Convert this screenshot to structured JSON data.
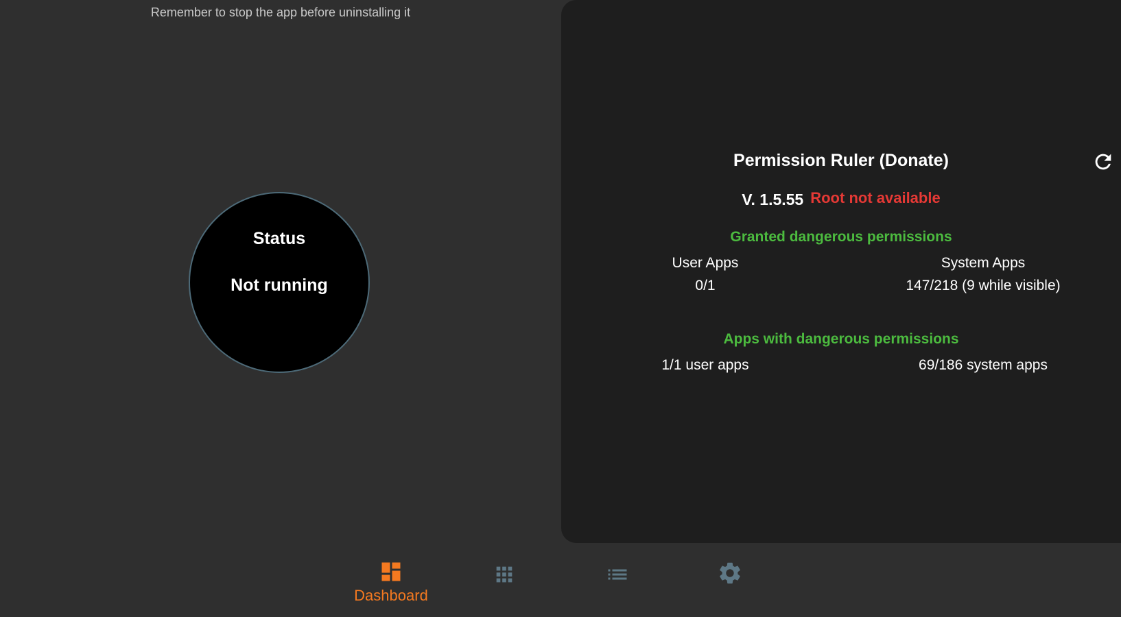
{
  "left_pane": {
    "hint": "Remember to stop the app before uninstalling it",
    "status_title": "Status",
    "status_value": "Not running"
  },
  "info_card": {
    "app_title": "Permission Ruler (Donate)",
    "refresh_icon": "refresh-icon",
    "version": "V. 1.5.55",
    "root_status": "Root not available",
    "granted_section": {
      "title": "Granted dangerous permissions",
      "user_label": "User Apps",
      "user_value": "0/1",
      "system_label": "System Apps",
      "system_value": "147/218 (9 while visible)"
    },
    "apps_section": {
      "title": "Apps with dangerous permissions",
      "user_value": "1/1 user apps",
      "system_value": "69/186 system apps"
    }
  },
  "bottom_nav": {
    "items": [
      {
        "label": "Dashboard",
        "icon": "dashboard-icon",
        "active": true
      },
      {
        "label": "",
        "icon": "apps-grid-icon",
        "active": false
      },
      {
        "label": "",
        "icon": "list-icon",
        "active": false
      },
      {
        "label": "",
        "icon": "gear-icon",
        "active": false
      }
    ]
  },
  "colors": {
    "background": "#2f2f2f",
    "card": "#1e1e1e",
    "accent": "#f47920",
    "success": "#4cbb3f",
    "error": "#e53935",
    "inactive_icon": "#5e7886",
    "circle_border": "#4d6a78"
  }
}
